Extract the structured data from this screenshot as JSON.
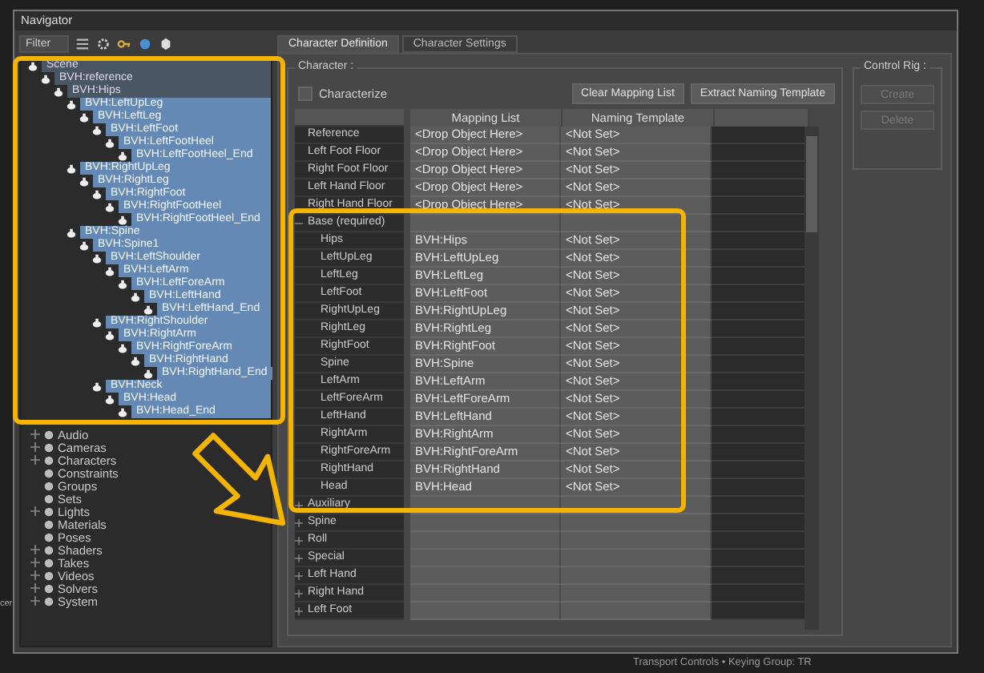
{
  "window": {
    "title": "Navigator"
  },
  "navigator": {
    "filter_label": "Filter",
    "scene_tree": [
      {
        "label": "Scene",
        "selected": false,
        "children": [
          {
            "label": "BVH:reference",
            "selected": false,
            "children": [
              {
                "label": "BVH:Hips",
                "selected": false,
                "children": [
                  {
                    "label": "BVH:LeftUpLeg",
                    "selected": true,
                    "children": [
                      {
                        "label": "BVH:LeftLeg",
                        "selected": true,
                        "children": [
                          {
                            "label": "BVH:LeftFoot",
                            "selected": true,
                            "children": [
                              {
                                "label": "BVH:LeftFootHeel",
                                "selected": true,
                                "children": [
                                  {
                                    "label": "BVH:LeftFootHeel_End",
                                    "selected": true
                                  }
                                ]
                              }
                            ]
                          }
                        ]
                      }
                    ]
                  },
                  {
                    "label": "BVH:RightUpLeg",
                    "selected": true,
                    "children": [
                      {
                        "label": "BVH:RightLeg",
                        "selected": true,
                        "children": [
                          {
                            "label": "BVH:RightFoot",
                            "selected": true,
                            "children": [
                              {
                                "label": "BVH:RightFootHeel",
                                "selected": true,
                                "children": [
                                  {
                                    "label": "BVH:RightFootHeel_End",
                                    "selected": true
                                  }
                                ]
                              }
                            ]
                          }
                        ]
                      }
                    ]
                  },
                  {
                    "label": "BVH:Spine",
                    "selected": true,
                    "children": [
                      {
                        "label": "BVH:Spine1",
                        "selected": true,
                        "children": [
                          {
                            "label": "BVH:LeftShoulder",
                            "selected": true,
                            "children": [
                              {
                                "label": "BVH:LeftArm",
                                "selected": true,
                                "children": [
                                  {
                                    "label": "BVH:LeftForeArm",
                                    "selected": true,
                                    "children": [
                                      {
                                        "label": "BVH:LeftHand",
                                        "selected": true,
                                        "children": [
                                          {
                                            "label": "BVH:LeftHand_End",
                                            "selected": true
                                          }
                                        ]
                                      }
                                    ]
                                  }
                                ]
                              }
                            ]
                          },
                          {
                            "label": "BVH:RightShoulder",
                            "selected": true,
                            "children": [
                              {
                                "label": "BVH:RightArm",
                                "selected": true,
                                "children": [
                                  {
                                    "label": "BVH:RightForeArm",
                                    "selected": true,
                                    "children": [
                                      {
                                        "label": "BVH:RightHand",
                                        "selected": true,
                                        "children": [
                                          {
                                            "label": "BVH:RightHand_End",
                                            "selected": true
                                          }
                                        ]
                                      }
                                    ]
                                  }
                                ]
                              }
                            ]
                          },
                          {
                            "label": "BVH:Neck",
                            "selected": true,
                            "children": [
                              {
                                "label": "BVH:Head",
                                "selected": true,
                                "children": [
                                  {
                                    "label": "BVH:Head_End",
                                    "selected": true
                                  }
                                ]
                              }
                            ]
                          }
                        ]
                      }
                    ]
                  }
                ]
              }
            ]
          }
        ]
      }
    ],
    "categories": [
      {
        "label": "Audio",
        "expandable": true
      },
      {
        "label": "Cameras",
        "expandable": true
      },
      {
        "label": "Characters",
        "expandable": true
      },
      {
        "label": "Constraints",
        "expandable": false
      },
      {
        "label": "Groups",
        "expandable": false
      },
      {
        "label": "Sets",
        "expandable": false
      },
      {
        "label": "Lights",
        "expandable": true
      },
      {
        "label": "Materials",
        "expandable": false
      },
      {
        "label": "Poses",
        "expandable": false
      },
      {
        "label": "Shaders",
        "expandable": true
      },
      {
        "label": "Takes",
        "expandable": true
      },
      {
        "label": "Videos",
        "expandable": true
      },
      {
        "label": "Solvers",
        "expandable": true
      },
      {
        "label": "System",
        "expandable": true
      }
    ]
  },
  "tabs": [
    {
      "label": "Character Definition",
      "selected": true
    },
    {
      "label": "Character Settings",
      "selected": false
    }
  ],
  "character": {
    "legend": "Character :",
    "characterize": {
      "label": "Characterize",
      "checked": false
    },
    "buttons": [
      "Clear Mapping List",
      "Extract Naming Template"
    ],
    "table": {
      "columns": [
        "Mapping List",
        "Naming Template"
      ],
      "rows": [
        {
          "kind": "slot",
          "name": "Reference",
          "mapping": "<Drop Object Here>",
          "template": "<Not Set>"
        },
        {
          "kind": "slot",
          "name": "Left Foot Floor",
          "mapping": "<Drop Object Here>",
          "template": "<Not Set>"
        },
        {
          "kind": "slot",
          "name": "Right Foot Floor",
          "mapping": "<Drop Object Here>",
          "template": "<Not Set>"
        },
        {
          "kind": "slot",
          "name": "Left Hand Floor",
          "mapping": "<Drop Object Here>",
          "template": "<Not Set>"
        },
        {
          "kind": "slot",
          "name": "Right Hand Floor",
          "mapping": "<Drop Object Here>",
          "template": "<Not Set>"
        },
        {
          "kind": "group",
          "name": "Base (required)",
          "expanded": true,
          "children": [
            {
              "name": "Hips",
              "mapping": "BVH:Hips",
              "template": "<Not Set>"
            },
            {
              "name": "LeftUpLeg",
              "mapping": "BVH:LeftUpLeg",
              "template": "<Not Set>"
            },
            {
              "name": "LeftLeg",
              "mapping": "BVH:LeftLeg",
              "template": "<Not Set>"
            },
            {
              "name": "LeftFoot",
              "mapping": "BVH:LeftFoot",
              "template": "<Not Set>"
            },
            {
              "name": "RightUpLeg",
              "mapping": "BVH:RightUpLeg",
              "template": "<Not Set>"
            },
            {
              "name": "RightLeg",
              "mapping": "BVH:RightLeg",
              "template": "<Not Set>"
            },
            {
              "name": "RightFoot",
              "mapping": "BVH:RightFoot",
              "template": "<Not Set>"
            },
            {
              "name": "Spine",
              "mapping": "BVH:Spine",
              "template": "<Not Set>"
            },
            {
              "name": "LeftArm",
              "mapping": "BVH:LeftArm",
              "template": "<Not Set>"
            },
            {
              "name": "LeftForeArm",
              "mapping": "BVH:LeftForeArm",
              "template": "<Not Set>"
            },
            {
              "name": "LeftHand",
              "mapping": "BVH:LeftHand",
              "template": "<Not Set>"
            },
            {
              "name": "RightArm",
              "mapping": "BVH:RightArm",
              "template": "<Not Set>"
            },
            {
              "name": "RightForeArm",
              "mapping": "BVH:RightForeArm",
              "template": "<Not Set>"
            },
            {
              "name": "RightHand",
              "mapping": "BVH:RightHand",
              "template": "<Not Set>"
            },
            {
              "name": "Head",
              "mapping": "BVH:Head",
              "template": "<Not Set>"
            }
          ]
        },
        {
          "kind": "group",
          "name": "Auxiliary",
          "expanded": false,
          "children": []
        },
        {
          "kind": "group",
          "name": "Spine",
          "expanded": false,
          "children": []
        },
        {
          "kind": "group",
          "name": "Roll",
          "expanded": false,
          "children": []
        },
        {
          "kind": "group",
          "name": "Special",
          "expanded": false,
          "children": []
        },
        {
          "kind": "group",
          "name": "Left Hand",
          "expanded": false,
          "children": []
        },
        {
          "kind": "group",
          "name": "Right Hand",
          "expanded": false,
          "children": []
        },
        {
          "kind": "group",
          "name": "Left Foot",
          "expanded": false,
          "children": []
        }
      ]
    }
  },
  "control_rig": {
    "legend": "Control Rig :",
    "buttons": [
      {
        "label": "Create",
        "disabled": true
      },
      {
        "label": "Delete",
        "disabled": true
      }
    ]
  },
  "viewport_fragment": "cer",
  "status_bar": "Transport Controls  •  Keying Group: TR"
}
